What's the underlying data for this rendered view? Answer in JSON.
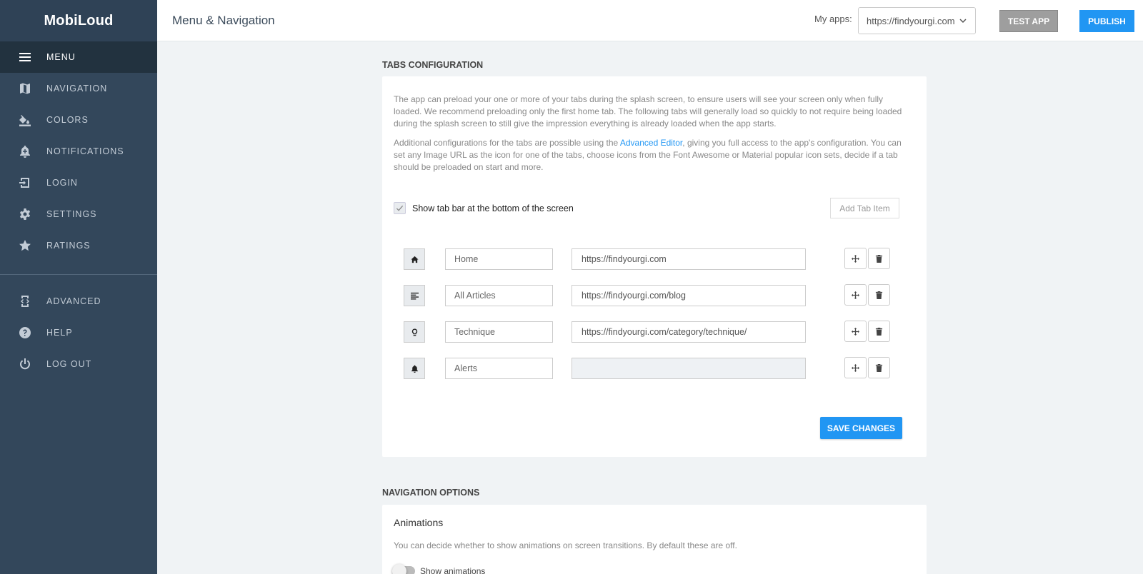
{
  "app": {
    "name": "MobiLoud"
  },
  "sidebar": {
    "items": [
      {
        "label": "MENU",
        "icon": "menu-icon"
      },
      {
        "label": "NAVIGATION",
        "icon": "map-icon"
      },
      {
        "label": "COLORS",
        "icon": "paint-bucket-icon"
      },
      {
        "label": "NOTIFICATIONS",
        "icon": "bell-plus-icon"
      },
      {
        "label": "LOGIN",
        "icon": "login-icon"
      },
      {
        "label": "SETTINGS",
        "icon": "gear-icon"
      },
      {
        "label": "RATINGS",
        "icon": "star-icon"
      }
    ],
    "secondary": [
      {
        "label": "ADVANCED",
        "icon": "code-device-icon"
      },
      {
        "label": "HELP",
        "icon": "help-icon"
      },
      {
        "label": "LOG OUT",
        "icon": "power-icon"
      }
    ]
  },
  "header": {
    "title": "Menu & Navigation",
    "myapps_label": "My apps:",
    "app_selected": "https://findyourgi.com",
    "test_button": "TEST APP",
    "publish_button": "PUBLISH"
  },
  "tabs_config": {
    "section_title": "TABS CONFIGURATION",
    "para1": "The app can preload your one or more of your tabs during the splash screen, to ensure users will see your screen only when fully loaded. We recommend preloading only the first home tab. The following tabs will generally load so quickly to not require being loaded during the splash screen to still give the impression everything is already loaded when the app starts.",
    "para2_before": "Additional configurations for the tabs are possible using the ",
    "para2_link": "Advanced Editor",
    "para2_after": ", giving you full access to the app's configuration. You can set any Image URL as the icon for one of the tabs, choose icons from the Font Awesome or Material popular icon sets, decide if a tab should be preloaded on start and more.",
    "show_tabbar_label": "Show tab bar at the bottom of the screen",
    "show_tabbar_checked": true,
    "add_tab_button": "Add Tab Item",
    "tabs": [
      {
        "icon": "home-icon",
        "name": "Home",
        "url": "https://findyourgi.com"
      },
      {
        "icon": "align-left-icon",
        "name": "All Articles",
        "url": "https://findyourgi.com/blog"
      },
      {
        "icon": "lightbulb-icon",
        "name": "Technique",
        "url": "https://findyourgi.com/category/technique/"
      },
      {
        "icon": "bell-icon",
        "name": "Alerts",
        "url": ""
      }
    ],
    "save_button": "SAVE CHANGES"
  },
  "nav_options": {
    "section_title": "NAVIGATION OPTIONS",
    "animations_title": "Animations",
    "animations_desc": "You can decide whether to show animations on screen transitions. By default these are off.",
    "show_animations_label": "Show animations",
    "show_animations_on": false
  }
}
